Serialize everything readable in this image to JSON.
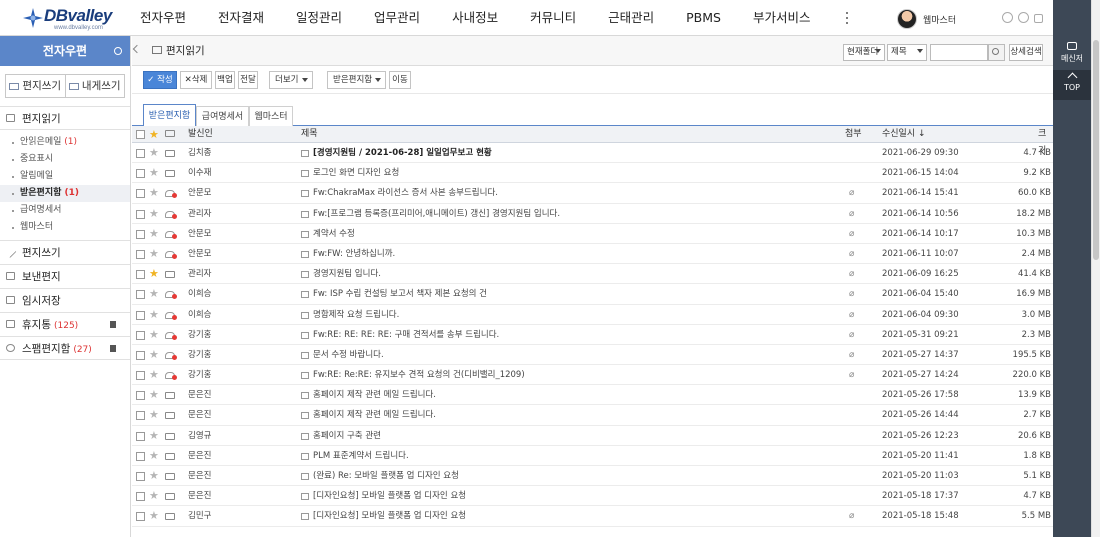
{
  "app": {
    "logo_text": "DBvalley",
    "logo_sub": "www.dbvalley.com",
    "nav": [
      "전자우편",
      "전자결재",
      "일정관리",
      "업무관리",
      "사내정보",
      "커뮤니티",
      "근태관리",
      "PBMS",
      "부가서비스"
    ],
    "user_name": "웹마스터"
  },
  "rail": {
    "messenger": "메신저",
    "top": "TOP"
  },
  "sidebar": {
    "title": "전자우편",
    "write_btn": "편지쓰기",
    "self_btn": "내게쓰기",
    "read_section": "편지읽기",
    "sub": [
      {
        "label": "안읽은메일",
        "count": "(1)"
      },
      {
        "label": "중요표시",
        "count": ""
      },
      {
        "label": "알림메일",
        "count": ""
      },
      {
        "label": "받은편지함",
        "count": "(1)"
      },
      {
        "label": "급여명세서",
        "count": ""
      },
      {
        "label": "웹마스터",
        "count": ""
      }
    ],
    "write_section": "편지쓰기",
    "sent": "보낸편지",
    "draft": "임시저장",
    "trash": "휴지통",
    "trash_count": "(125)",
    "spam": "스팸편지함",
    "spam_count": "(27)"
  },
  "main": {
    "title": "편지읽기",
    "search": {
      "scope": "현재폴더",
      "field": "제목",
      "advanced": "상세검색"
    },
    "toolbar": {
      "write": "✓ 작성",
      "delete": "✕삭제",
      "backup": "백업",
      "forward": "전달",
      "more": "더보기",
      "folder": "받은편지함",
      "move": "이동"
    },
    "tabs": [
      "받은편지함",
      "급여명세서",
      "웹마스터"
    ],
    "columns": {
      "sender": "발신인",
      "subject": "제목",
      "attach": "첨부",
      "date": "수신일시 ↓",
      "size": "크기"
    },
    "rows": [
      {
        "sender": "김치종",
        "subject": "[경영지원팀 / 2021-06-28] 일일업무보고 현황",
        "date": "2021-06-29 09:30",
        "size": "4.7 KB",
        "bold": true,
        "star": false,
        "red": false,
        "attach": false
      },
      {
        "sender": "이수재",
        "subject": "로그인 화면 디자인 요청",
        "date": "2021-06-15 14:04",
        "size": "9.2 KB",
        "bold": false,
        "star": false,
        "red": false,
        "attach": false
      },
      {
        "sender": "안문모",
        "subject": "Fw:ChakraMax 라이선스 증서 사본 송부드립니다.",
        "date": "2021-06-14 15:41",
        "size": "60.0 KB",
        "bold": false,
        "star": false,
        "red": true,
        "attach": true
      },
      {
        "sender": "관리자",
        "subject": "Fw:[프로그램 등록증(프리미어,애니메이트) 갱신] 경영지원팀 입니다.",
        "date": "2021-06-14 10:56",
        "size": "18.2 MB",
        "bold": false,
        "star": false,
        "red": true,
        "attach": true
      },
      {
        "sender": "안문모",
        "subject": "계약서 수정",
        "date": "2021-06-14 10:17",
        "size": "10.3 MB",
        "bold": false,
        "star": false,
        "red": true,
        "attach": true
      },
      {
        "sender": "안문모",
        "subject": "Fw:FW: 안녕하십니까.",
        "date": "2021-06-11 10:07",
        "size": "2.4 MB",
        "bold": false,
        "star": false,
        "red": true,
        "attach": true
      },
      {
        "sender": "관리자",
        "subject": "경영지원팀 입니다.",
        "date": "2021-06-09 16:25",
        "size": "41.4 KB",
        "bold": false,
        "star": true,
        "red": false,
        "attach": true
      },
      {
        "sender": "이희승",
        "subject": "Fw: ISP 수립 컨설팅 보고서 책자 제본 요청의 건",
        "date": "2021-06-04 15:40",
        "size": "16.9 MB",
        "bold": false,
        "star": false,
        "red": true,
        "attach": true
      },
      {
        "sender": "이희승",
        "subject": "명함제작 요청 드립니다.",
        "date": "2021-06-04 09:30",
        "size": "3.0 MB",
        "bold": false,
        "star": false,
        "red": true,
        "attach": true
      },
      {
        "sender": "강기홍",
        "subject": "Fw:RE: RE: RE: RE: 구매 견적서를 송부 드립니다.",
        "date": "2021-05-31 09:21",
        "size": "2.3 MB",
        "bold": false,
        "star": false,
        "red": true,
        "attach": true
      },
      {
        "sender": "강기홍",
        "subject": "문서 수정 바랍니다.",
        "date": "2021-05-27 14:37",
        "size": "195.5 KB",
        "bold": false,
        "star": false,
        "red": true,
        "attach": true
      },
      {
        "sender": "강기홍",
        "subject": "Fw:RE: Re:RE: 유지보수 견적 요청의 건(디비밸리_1209)",
        "date": "2021-05-27 14:24",
        "size": "220.0 KB",
        "bold": false,
        "star": false,
        "red": true,
        "attach": true
      },
      {
        "sender": "문은진",
        "subject": "홈페이지 제작 관련 메일 드립니다.",
        "date": "2021-05-26 17:58",
        "size": "13.9 KB",
        "bold": false,
        "star": false,
        "red": false,
        "attach": false
      },
      {
        "sender": "문은진",
        "subject": "홈페이지 제작 관련 메일 드립니다.",
        "date": "2021-05-26 14:44",
        "size": "2.7 KB",
        "bold": false,
        "star": false,
        "red": false,
        "attach": false
      },
      {
        "sender": "김영규",
        "subject": "홈페이지 구축 관련",
        "date": "2021-05-26 12:23",
        "size": "20.6 KB",
        "bold": false,
        "star": false,
        "red": false,
        "attach": false
      },
      {
        "sender": "문은진",
        "subject": "PLM 표준계약서 드립니다.",
        "date": "2021-05-20 11:41",
        "size": "1.8 KB",
        "bold": false,
        "star": false,
        "red": false,
        "attach": false
      },
      {
        "sender": "문은진",
        "subject": "(완료) Re: 모바일 플랫폼 업 디자인 요청",
        "date": "2021-05-20 11:03",
        "size": "5.1 KB",
        "bold": false,
        "star": false,
        "red": false,
        "attach": false
      },
      {
        "sender": "문은진",
        "subject": "[디자인요청] 모바일 플랫폼 업 디자인 요청",
        "date": "2021-05-18 17:37",
        "size": "4.7 KB",
        "bold": false,
        "star": false,
        "red": false,
        "attach": false
      },
      {
        "sender": "김민구",
        "subject": "[디자인요청] 모바일 플랫폼 업 디자인 요청",
        "date": "2021-05-18 15:48",
        "size": "5.5 MB",
        "bold": false,
        "star": false,
        "red": false,
        "attach": true
      }
    ]
  }
}
